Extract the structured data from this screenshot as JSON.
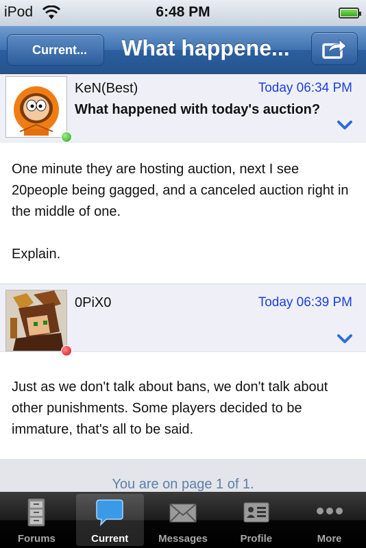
{
  "status_bar": {
    "carrier": "iPod",
    "time": "6:48 PM"
  },
  "nav": {
    "back_label": "Current...",
    "title": "What happene..."
  },
  "posts": [
    {
      "author": "KeN(Best)",
      "time": "Today 06:34 PM",
      "title": "What happened with today's auction?",
      "status": "online",
      "body": [
        "One minute they are hosting auction, next I see 20people being gagged, and a canceled auction right in the middle of one.",
        "Explain."
      ]
    },
    {
      "author": "0PiX0",
      "time": "Today 06:39 PM",
      "title": "",
      "status": "offline",
      "body": [
        "Just as we don't talk about bans, we don't talk about other punishments. Some players decided to be immature, that's all to be said."
      ]
    }
  ],
  "pager": {
    "text": "You are on page 1 of 1."
  },
  "tabs": [
    {
      "label": "Forums",
      "icon": "cabinet-icon"
    },
    {
      "label": "Current",
      "icon": "chat-bubble-icon",
      "selected": true
    },
    {
      "label": "Messages",
      "icon": "envelope-icon"
    },
    {
      "label": "Profile",
      "icon": "profile-card-icon"
    },
    {
      "label": "More",
      "icon": "more-dots-icon"
    }
  ],
  "colors": {
    "nav_blue": "#3f73b2",
    "link_blue": "#1a3fe0",
    "online": "#2ea11c",
    "offline": "#d0101c"
  }
}
